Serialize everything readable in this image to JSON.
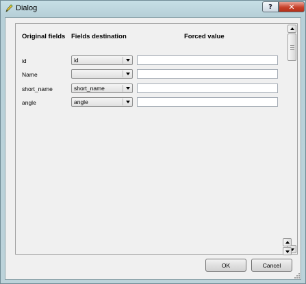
{
  "window": {
    "title": "Dialog",
    "help_label": "?",
    "close_label": "✕"
  },
  "headers": {
    "original": "Original fields",
    "destination": "Fields destination",
    "forced": "Forced value"
  },
  "rows": [
    {
      "original": "id",
      "destination": "id",
      "forced": ""
    },
    {
      "original": "Name",
      "destination": "",
      "forced": ""
    },
    {
      "original": "short_name",
      "destination": "short_name",
      "forced": ""
    },
    {
      "original": "angle",
      "destination": "angle",
      "forced": ""
    }
  ],
  "buttons": {
    "ok": "OK",
    "cancel": "Cancel"
  },
  "icons": {
    "title": "pencil-icon",
    "help": "help-icon",
    "close": "close-icon",
    "dropdown": "chevron-down-icon",
    "scroll_up": "arrow-up-icon",
    "scroll_down": "arrow-down-icon",
    "resize": "resize-grip-icon"
  },
  "colors": {
    "close_button": "#c7412a",
    "titlebar": "#c6dfe6",
    "client_bg": "#f0f0f0"
  }
}
